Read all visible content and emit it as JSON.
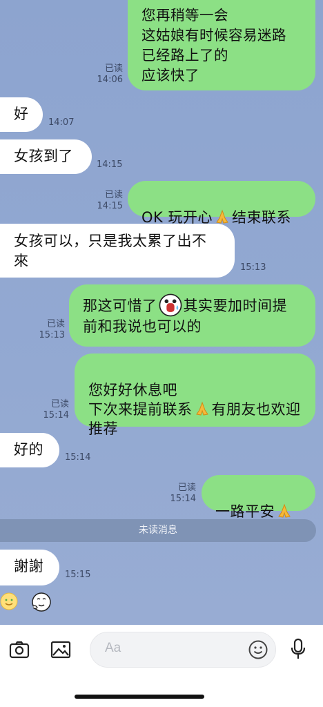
{
  "messages": [
    {
      "text": "您再稍等一会\n这姑娘有时候容易迷路\n已经路上了的\n应该快了",
      "read": "已读",
      "time": "14:06"
    },
    {
      "text": "好",
      "time": "14:07"
    },
    {
      "text": "女孩到了",
      "time": "14:15"
    },
    {
      "text_a": "OK 玩开心",
      "text_b": "结束联系",
      "read": "已读",
      "time": "14:15"
    },
    {
      "text": "女孩可以，只是我太累了出不來",
      "time": "15:13"
    },
    {
      "text_a": "那这可惜了",
      "text_b": "其实要加时间提前和我说也可以的",
      "read": "已读",
      "time": "15:13"
    },
    {
      "text_a": "您好好休息吧\n下次来提前联系",
      "text_b": "有朋友也欢迎推荐",
      "read": "已读",
      "time": "15:14"
    },
    {
      "text": "好的",
      "time": "15:14"
    },
    {
      "text_a": "一路平安",
      "read": "已读",
      "time": "15:14"
    },
    {
      "text": "謝謝",
      "time": "15:15"
    }
  ],
  "divider": {
    "label": "未读消息"
  },
  "input": {
    "placeholder": "Aa"
  },
  "icons": {
    "camera": "camera-icon",
    "gallery": "image-icon",
    "emoji": "smiley-icon",
    "mic": "microphone-icon"
  },
  "colors": {
    "outgoing": "#8ce085",
    "incoming": "#ffffff",
    "background": "#8fa6cf"
  }
}
